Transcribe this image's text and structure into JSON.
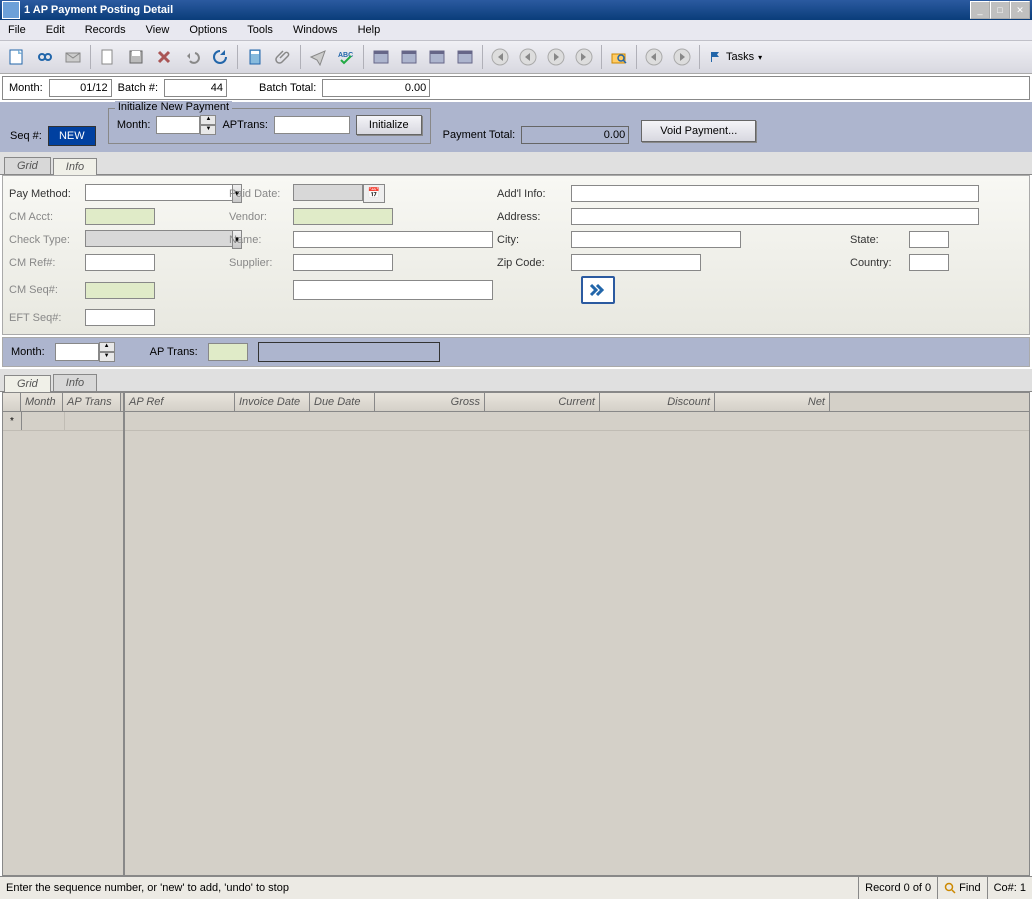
{
  "window": {
    "title": "1 AP Payment Posting Detail"
  },
  "menu": {
    "file": "File",
    "edit": "Edit",
    "records": "Records",
    "view": "View",
    "options": "Options",
    "tools": "Tools",
    "windows": "Windows",
    "help": "Help"
  },
  "toolbar": {
    "tasks": "Tasks"
  },
  "header": {
    "month_label": "Month:",
    "month_value": "01/12",
    "batch_label": "Batch #:",
    "batch_value": "44",
    "batch_total_label": "Batch Total:",
    "batch_total_value": "0.00"
  },
  "seq": {
    "label": "Seq #:",
    "value": "NEW"
  },
  "init": {
    "legend": "Initialize New Payment",
    "month_label": "Month:",
    "month_value": "",
    "aptrans_label": "APTrans:",
    "aptrans_value": "",
    "button": "Initialize"
  },
  "payment_total": {
    "label": "Payment Total:",
    "value": "0.00"
  },
  "void_button": "Void Payment...",
  "tabs_upper": {
    "grid": "Grid",
    "info": "Info"
  },
  "info": {
    "pay_method_label": "Pay Method:",
    "pay_method_value": "",
    "cm_acct_label": "CM Acct:",
    "cm_acct_value": "",
    "check_type_label": "Check Type:",
    "check_type_value": "",
    "cm_ref_label": "CM Ref#:",
    "cm_ref_value": "",
    "cm_seq_label": "CM Seq#:",
    "cm_seq_value": "",
    "eft_seq_label": "EFT Seq#:",
    "eft_seq_value": "",
    "paid_date_label": "Paid Date:",
    "paid_date_value": "",
    "vendor_label": "Vendor:",
    "vendor_value": "",
    "name_label": "Name:",
    "name_value": "",
    "supplier_label": "Supplier:",
    "supplier_value": "",
    "addl_info_label": "Add'l Info:",
    "addl_info_value": "",
    "address_label": "Address:",
    "address_value": "",
    "city_label": "City:",
    "city_value": "",
    "state_label": "State:",
    "state_value": "",
    "zip_label": "Zip Code:",
    "zip_value": "",
    "country_label": "Country:",
    "country_value": ""
  },
  "mid": {
    "month_label": "Month:",
    "month_value": "",
    "aptrans_label": "AP Trans:",
    "aptrans_value": "",
    "desc_value": ""
  },
  "tabs_lower": {
    "grid": "Grid",
    "info": "Info"
  },
  "grid_cols_left": {
    "month": "Month",
    "aptrans": "AP Trans"
  },
  "grid_cols_right": {
    "apref": "AP Ref",
    "invoice_date": "Invoice Date",
    "due_date": "Due Date",
    "gross": "Gross",
    "current": "Current",
    "discount": "Discount",
    "net": "Net"
  },
  "status": {
    "hint": "Enter the sequence number, or 'new' to add, 'undo' to stop",
    "record": "Record 0 of 0",
    "find": "Find",
    "co": "Co#: 1"
  }
}
